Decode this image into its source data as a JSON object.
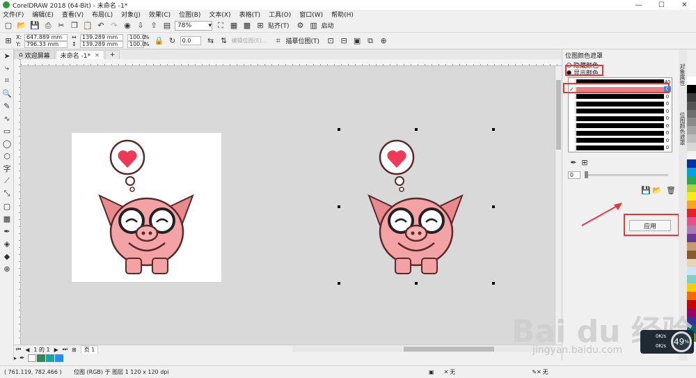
{
  "window": {
    "title": "CorelDRAW 2018 (64-Bit) - 未命名 -1*",
    "minimize": "—",
    "maximize": "☐",
    "close": "✕"
  },
  "menu": [
    "文件(F)",
    "编辑(E)",
    "查看(V)",
    "布局(L)",
    "对象(J)",
    "效果(C)",
    "位图(B)",
    "文本(X)",
    "表格(T)",
    "工具(O)",
    "窗口(W)",
    "帮助(H)"
  ],
  "toolbar": {
    "zoom": "78%",
    "snap_label": "贴齐(T)",
    "launch_label": "启动"
  },
  "propbar": {
    "x": "647.889 mm",
    "y": "796.33 mm",
    "w": "139.289 mm",
    "h": "139.289 mm",
    "pct_w": "100.0",
    "pct_h": "100.0",
    "pct_unit": "%",
    "rotation": "0.0",
    "edit_bitmap": "编辑位图(E)...",
    "trace_bitmap": "描摹位图(T)"
  },
  "tabs": [
    {
      "label": "欢迎屏幕"
    },
    {
      "label": "未命名 -1*"
    }
  ],
  "tab_add": "+",
  "bottom": {
    "page_counter": "1 的 1",
    "page_tab": "页 1"
  },
  "status": {
    "coords": "( 761.119, 782.466 )",
    "info": "位图 (RGB) 于 图层 1 120 x 120 dpi",
    "fill_none": "无",
    "outline_none": "无"
  },
  "docker": {
    "title": "位图颜色遮罩",
    "hide_colors": "隐藏颜色",
    "show_colors": "显示颜色",
    "selected_mode": "show",
    "rows": [
      {
        "checked": false,
        "color": "#000000",
        "value": "40"
      },
      {
        "checked": true,
        "color": "#e87f86",
        "value": "0"
      },
      {
        "checked": false,
        "color": "#000000",
        "value": "0"
      },
      {
        "checked": false,
        "color": "#000000",
        "value": "0"
      },
      {
        "checked": false,
        "color": "#000000",
        "value": "0"
      },
      {
        "checked": false,
        "color": "#000000",
        "value": "0"
      },
      {
        "checked": false,
        "color": "#000000",
        "value": "0"
      },
      {
        "checked": false,
        "color": "#000000",
        "value": "0"
      },
      {
        "checked": false,
        "color": "#000000",
        "value": "0"
      },
      {
        "checked": false,
        "color": "#000000",
        "value": "0"
      }
    ],
    "tolerance": "0",
    "apply": "应用",
    "side_tab_1": "对象属性",
    "side_tab_2": "位图颜色遮罩"
  },
  "palette": [
    "#ffffff",
    "#000000",
    "#3a3a3a",
    "#555555",
    "#6f6f6f",
    "#8a8a8a",
    "#a4a4a4",
    "#bebebe",
    "#d8d8d8",
    "#f2f2f2",
    "#0033aa",
    "#00a0e0",
    "#2aa84a",
    "#b2d234",
    "#f7ec13",
    "#f6a623",
    "#e3222a",
    "#e8528c",
    "#b07ab3",
    "#6b3a93",
    "#c69c6d",
    "#8b5a2b",
    "#e6d4b5",
    "#cde6f5",
    "#7fd0c7",
    "#ffcc00",
    "#ff6600",
    "#cc0000",
    "#990066",
    "#333399",
    "#006666",
    "#669900"
  ],
  "colors": {
    "accent_red": "#e23a3a",
    "canvas": "#d9d9d9",
    "pig_pink": "#f3a3a5"
  },
  "watermark": {
    "brand": "Bai du 经验",
    "url": "jingyan.baidu.com"
  },
  "net_widget": {
    "up": "0K/s",
    "down": "0K/s",
    "value": "49",
    "unit": "%"
  }
}
